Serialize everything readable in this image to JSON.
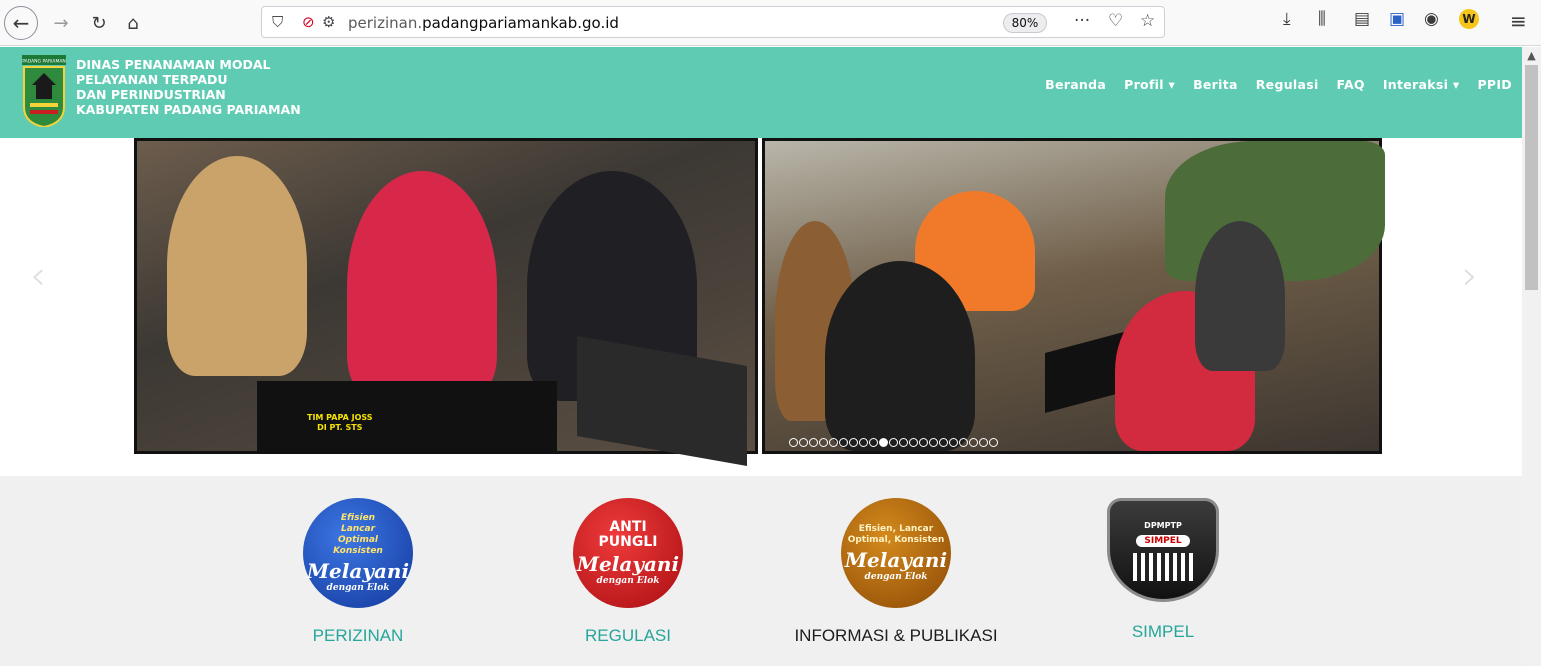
{
  "browser": {
    "url_prefix": "perizinan.",
    "url_host": "padangpariamankab.go.id",
    "zoom": "80%"
  },
  "site": {
    "org_lines": [
      "DINAS PENANAMAN MODAL",
      "PELAYANAN TERPADU",
      "DAN PERINDUSTRIAN",
      "KABUPATEN PADANG PARIAMAN"
    ],
    "logo_text": "PADANG PARIAMAN",
    "menu": [
      "Beranda",
      "Profil ▾",
      "Berita",
      "Regulasi",
      "FAQ",
      "Interaksi ▾",
      "PPID"
    ]
  },
  "carousel": {
    "caption_line1": "TIM PAPA JOSS",
    "caption_line2": "DI PT. STS",
    "dot_count": 21,
    "active_dot": 9
  },
  "services": [
    {
      "label": "PERIZINAN",
      "badge_small": "Efisien\nLancar\nOptimal\nKonsisten",
      "badge_script": "Melayani",
      "badge_sub": "dengan Elok"
    },
    {
      "label": "REGULASI",
      "badge_big": "ANTI\nPUNGLI",
      "badge_script": "Melayani",
      "badge_sub": "dengan Elok"
    },
    {
      "label": "INFORMASI & PUBLIKASI",
      "badge_small": "Efisien, Lancar\nOptimal, Konsisten",
      "badge_script": "Melayani",
      "badge_sub": "dengan Elok"
    },
    {
      "label": "SIMPEL",
      "badge_small": "DPMPTP",
      "badge_script": "SIMPEL"
    }
  ]
}
